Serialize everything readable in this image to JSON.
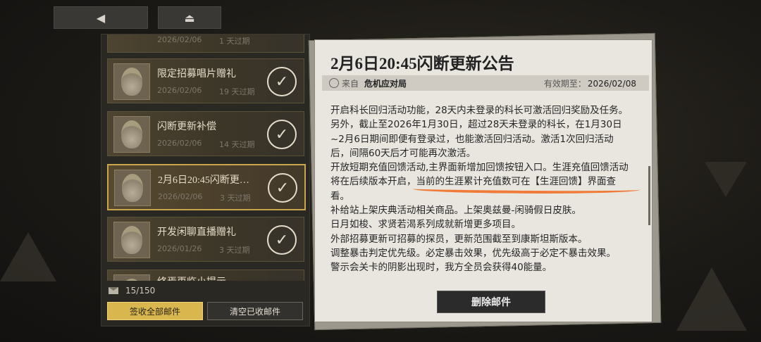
{
  "nav": {
    "back_icon": "back-arrow-icon",
    "home_icon": "home-icon"
  },
  "mail_list": {
    "partial_top": {
      "date": "2026/02/06",
      "expiry": "1 天过期"
    },
    "items": [
      {
        "title": "限定招募唱片赠礼",
        "date": "2026/02/06",
        "expiry": "19 天过期",
        "selected": false
      },
      {
        "title": "闪断更新补偿",
        "date": "2026/02/06",
        "expiry": "14 天过期",
        "selected": false
      },
      {
        "title": "2月6日20:45闪断更…",
        "date": "2026/02/06",
        "expiry": "3 天过期",
        "selected": true
      },
      {
        "title": "开发闲聊直播赠礼",
        "date": "2026/01/26",
        "expiry": "3 天过期",
        "selected": false
      }
    ],
    "partial_bottom": {
      "title": "终焉再临小提示"
    },
    "count": "15/150",
    "claim_all_label": "签收全部邮件",
    "clear_read_label": "清空已收邮件"
  },
  "detail": {
    "title": "2月6日20:45闪断更新公告",
    "from_label": "来自",
    "sender": "危机应对局",
    "valid_label": "有效期至：",
    "valid_date": "2026/02/08",
    "lines": [
      "开启科长回归活动功能，28天内未登录的科长可激活回归奖励及任务。",
      "另外，截止至2026年1月30日，超过28天未登录的科长，在1月30日",
      "~2月6日期间即便有登录过，也能激活回归活动。激活1次回归活动",
      "后，间隔60天后才可能再次激活。",
      "开放短期充值回馈活动,主界面新增加回馈按钮入口。生涯充值回馈活动",
      "将在后续版本开启，当前的生涯累计充值数可在【生涯回馈】界面查",
      "看。",
      "补给站上架庆典活动相关商品。上架奥兹曼-闲骑假日皮肤。",
      "日月如梭、求贤若渴系列成就新增更多项目。",
      "外部招募更新可招募的探员，更新范围截至到康斯坦斯版本。",
      "调整暴击判定优先级。必定暴击效果，优先级高于必定不暴击效果。",
      "警示会关卡的阴影出现时，我方全员会获得40能量。"
    ],
    "delete_label": "删除邮件"
  }
}
